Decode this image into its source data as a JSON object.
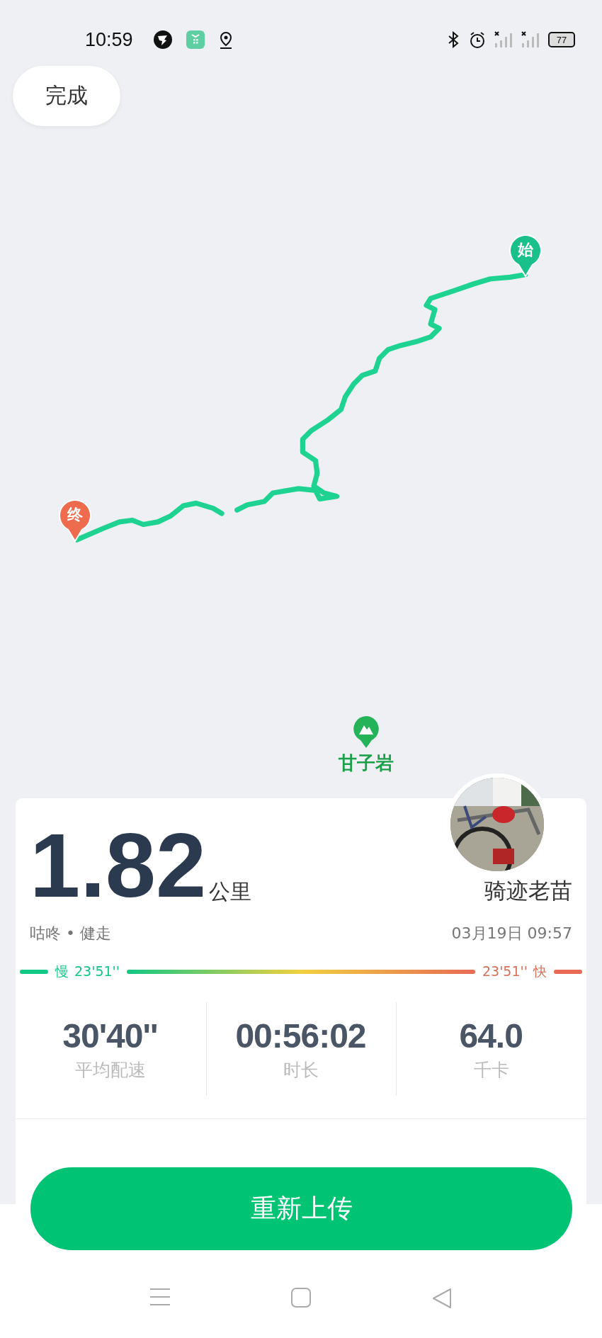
{
  "status_bar": {
    "time": "10:59",
    "battery": "77"
  },
  "done_button": {
    "label": "完成"
  },
  "map": {
    "start_marker": "始",
    "end_marker": "终",
    "place_label": "甘子岩"
  },
  "summary": {
    "distance": "1.82",
    "unit": "公里",
    "user_name": "骑迹老苗",
    "activity": "咕咚 • 健走",
    "date_time": "03月19日 09:57"
  },
  "pace_bar": {
    "slow_label": "慢",
    "slow_value": "23'51''",
    "fast_value": "23'51''",
    "fast_label": "快"
  },
  "stats": [
    {
      "value": "30'40''",
      "label": "平均配速"
    },
    {
      "value": "00:56:02",
      "label": "时长"
    },
    {
      "value": "64.0",
      "label": "千卡"
    }
  ],
  "upload_button": {
    "label": "重新上传"
  }
}
